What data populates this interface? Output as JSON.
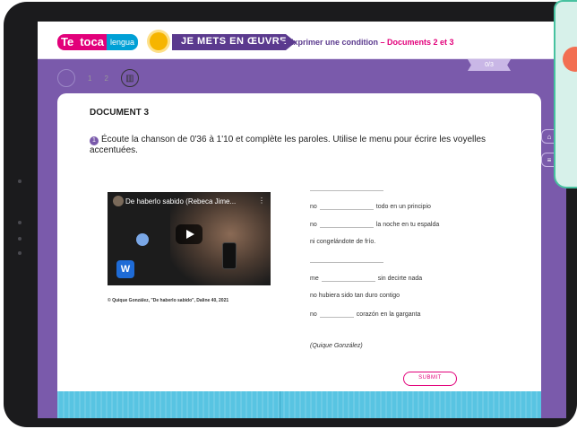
{
  "header": {
    "logo_te": "Te",
    "logo_toca": "toca",
    "logo_lengua": "lengua",
    "section_label": "JE METS EN ŒUVRE",
    "breadcrumb_arrow": "▶",
    "breadcrumb_main": "Exprimer une condition",
    "breadcrumb_dash": " – ",
    "breadcrumb_docs": "Documents 2 et 3",
    "pager": "0/3"
  },
  "nav": {
    "step1": "1",
    "step2": "2"
  },
  "side_tabs": [
    "⌂",
    "≡"
  ],
  "document": {
    "title": "DOCUMENT 3",
    "instruction_number": "1",
    "instruction": "Écoute la chanson de 0'36 à 1'10 et complète les paroles. Utilise le menu pour écrire les voyelles accentuées."
  },
  "video": {
    "title": "De haberlo sabido (Rebeca Jime...",
    "more": "⋮",
    "logo": "W",
    "caption": "© Quique González, \"De haberlo sabido\", Daline 40, 2021"
  },
  "lyrics": {
    "l1": "todo en un principio",
    "l2": "la noche en tu espalda",
    "l3": "ni congelándote de frío.",
    "l4": "sin decirte nada",
    "l5": "no hubiera sido tan duro contigo",
    "l6": "corazón en la garganta",
    "word_no": "no",
    "word_me": "me",
    "author": "(Quique González)"
  },
  "submit_label": "SUBMIT"
}
